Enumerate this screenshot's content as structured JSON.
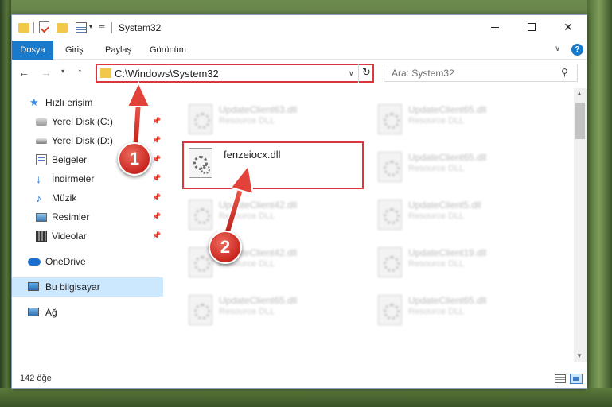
{
  "window": {
    "title": "System32"
  },
  "ribbon": {
    "tabs": [
      "Dosya",
      "Giriş",
      "Paylaş",
      "Görünüm"
    ]
  },
  "navigation": {
    "address": "C:\\Windows\\System32",
    "search_placeholder": "Ara: System32"
  },
  "sidebar": {
    "items": [
      {
        "label": "Hızlı erişim",
        "icon": "star-icon"
      },
      {
        "label": "Yerel Disk (C:)",
        "icon": "drive-icon",
        "pinned": true
      },
      {
        "label": "Yerel Disk (D:)",
        "icon": "drive-icon",
        "pinned": true
      },
      {
        "label": "Belgeler",
        "icon": "documents-icon",
        "pinned": true
      },
      {
        "label": "İndirmeler",
        "icon": "download-icon",
        "pinned": true
      },
      {
        "label": "Müzik",
        "icon": "music-icon",
        "pinned": true
      },
      {
        "label": "Resimler",
        "icon": "pictures-icon",
        "pinned": true
      },
      {
        "label": "Videolar",
        "icon": "videos-icon",
        "pinned": true
      },
      {
        "label": "OneDrive",
        "icon": "cloud-icon"
      },
      {
        "label": "Bu bilgisayar",
        "icon": "computer-icon",
        "selected": true
      },
      {
        "label": "Ağ",
        "icon": "network-icon"
      }
    ]
  },
  "files": [
    {
      "name": "UpdateClient63.dll",
      "type": "Resource DLL",
      "blurred": true
    },
    {
      "name": "UpdateClient65.dll",
      "type": "Resource DLL",
      "blurred": true
    },
    {
      "name": "fenzeiocx.dll",
      "type": "",
      "blurred": false,
      "highlighted": true
    },
    {
      "name": "UpdateClient65.dll",
      "type": "Resource DLL",
      "blurred": true
    },
    {
      "name": "UpdateClient42.dll",
      "type": "Resource DLL",
      "blurred": true
    },
    {
      "name": "UpdateClient5.dll",
      "type": "Resource DLL",
      "blurred": true
    },
    {
      "name": "UpdateClient42.dll",
      "type": "Resource DLL",
      "blurred": true
    },
    {
      "name": "UpdateClient19.dll",
      "type": "Resource DLL",
      "blurred": true
    },
    {
      "name": "UpdateClient65.dll",
      "type": "Resource DLL",
      "blurred": true
    },
    {
      "name": "UpdateClient65.dll",
      "type": "Resource DLL",
      "blurred": true
    }
  ],
  "status": {
    "item_count": "142 öğe"
  },
  "annotations": {
    "step1": "1",
    "step2": "2"
  },
  "colors": {
    "accent": "#1979ca",
    "highlight_border": "#d9363e",
    "selection": "#cce8ff"
  }
}
